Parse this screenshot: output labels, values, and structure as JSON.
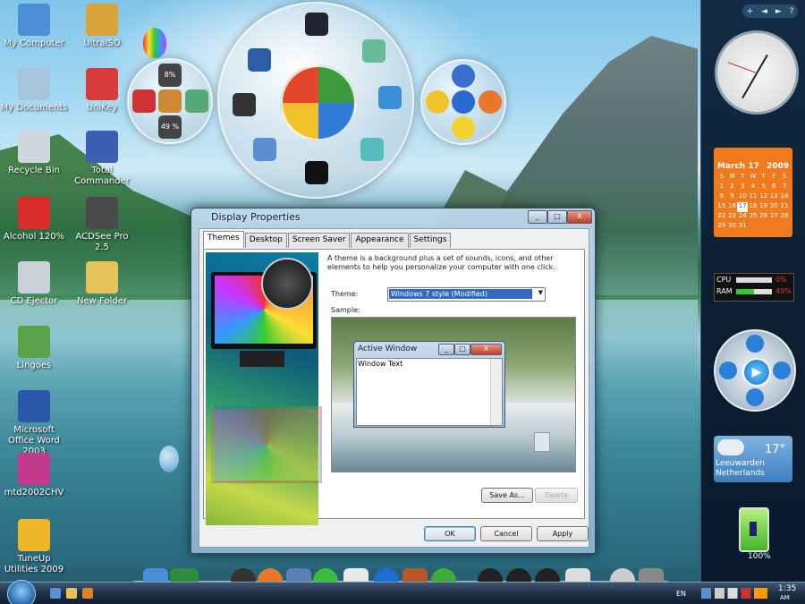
{
  "desktop_icons": [
    {
      "label": "My Computer",
      "icon": "computer-icon",
      "color": "#4d8fd6"
    },
    {
      "label": "UltraISO",
      "icon": "disc-icon",
      "color": "#d9a33b"
    },
    {
      "label": "My Documents",
      "icon": "documents-icon",
      "color": "#a7c4dd"
    },
    {
      "label": "UniKey",
      "icon": "unikey-icon",
      "color": "#d93a3a"
    },
    {
      "label": "Recycle Bin",
      "icon": "recycle-bin-icon",
      "color": "#cfd8df"
    },
    {
      "label": "Total Commander",
      "icon": "floppy-icon",
      "color": "#3c5fb3"
    },
    {
      "label": "Alcohol 120%",
      "icon": "alcohol-icon",
      "color": "#d92d2d"
    },
    {
      "label": "ACDSee Pro 2.5",
      "icon": "acdsee-icon",
      "color": "#4a4a4a"
    },
    {
      "label": "CD Ejector",
      "icon": "cd-icon",
      "color": "#c9d1d8"
    },
    {
      "label": "New Folder",
      "icon": "folder-icon",
      "color": "#e6c25a"
    },
    {
      "label": "Lingoes",
      "icon": "lingoes-icon",
      "color": "#5aa14a"
    },
    {
      "label": "Microsoft Office Word 2003",
      "icon": "word-icon",
      "color": "#2b58a9"
    },
    {
      "label": "mtd2002CHV",
      "icon": "mtd-icon",
      "color": "#c23b8f"
    },
    {
      "label": "TuneUp Utilities 2009",
      "icon": "tuneup-icon",
      "color": "#f0b62b"
    }
  ],
  "launcher": {
    "left_percent_top": "8%",
    "left_percent_bottom": "49 %"
  },
  "window": {
    "title": "Display Properties",
    "minimize": "_",
    "maximize": "□",
    "close": "X",
    "tabs": [
      "Themes",
      "Desktop",
      "Screen Saver",
      "Appearance",
      "Settings"
    ],
    "active_tab": "Themes",
    "description": "A theme is a background plus a set of sounds, icons, and other elements to help you personalize your computer with one click.",
    "theme_label": "Theme:",
    "theme_value": "Windows 7 style (Modified)",
    "sample_label": "Sample:",
    "active_window_title": "Active Window",
    "window_text": "Window Text",
    "buttons": {
      "save_as": "Save As...",
      "delete": "Delete",
      "ok": "OK",
      "cancel": "Cancel",
      "apply": "Apply"
    }
  },
  "sidebar": {
    "top_controls": [
      "+",
      "◄",
      "►",
      "?"
    ],
    "calendar": {
      "month": "March 17",
      "year": "2009",
      "days_header": [
        "S",
        "M",
        "T",
        "W",
        "T",
        "F",
        "S"
      ],
      "weeks": [
        [
          "1",
          "2",
          "3",
          "4",
          "5",
          "6",
          "7"
        ],
        [
          "8",
          "9",
          "10",
          "11",
          "12",
          "13",
          "14"
        ],
        [
          "15",
          "16",
          "17",
          "18",
          "19",
          "20",
          "21"
        ],
        [
          "22",
          "23",
          "24",
          "25",
          "26",
          "27",
          "28"
        ],
        [
          "29",
          "30",
          "31",
          "",
          "",
          "",
          ""
        ]
      ],
      "today": "17"
    },
    "cpu": {
      "cpu_label": "CPU",
      "cpu_value": "0%",
      "cpu_level": 0.0,
      "ram_label": "RAM",
      "ram_value": "49%",
      "ram_level": 0.49
    },
    "weather": {
      "temp": "17°",
      "city": "Leeuwarden",
      "country": "Netherlands"
    },
    "battery": {
      "percent": "100%",
      "level": 1.0
    }
  },
  "taskbar": {
    "language": "EN",
    "time": "1:35",
    "ampm": "AM"
  },
  "colors": {
    "accent": "#316ac5",
    "calendar": "#f07a1e",
    "close": "#c43b25"
  }
}
